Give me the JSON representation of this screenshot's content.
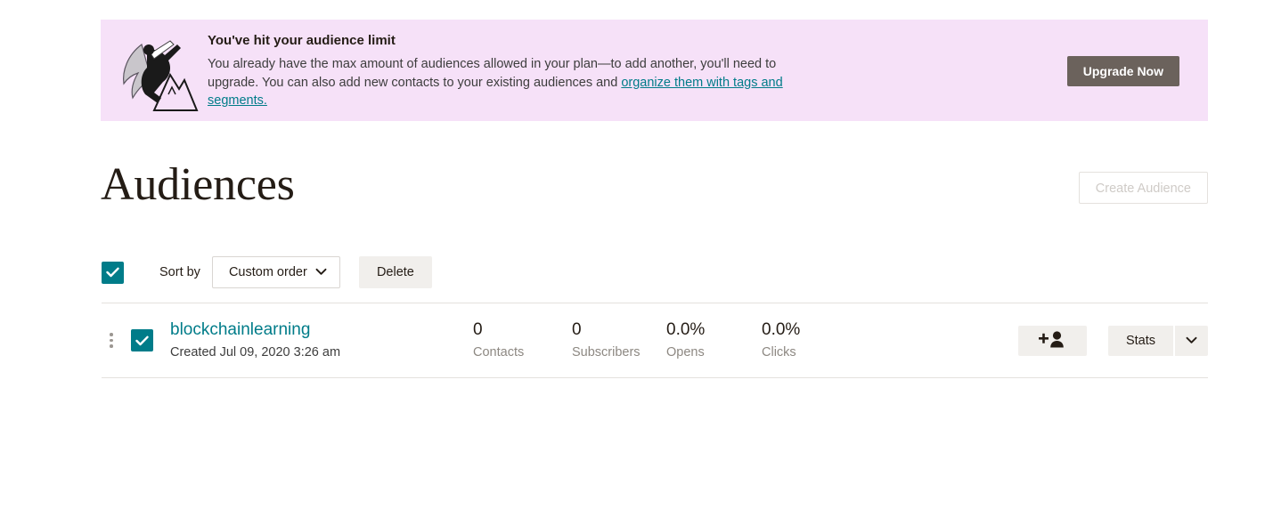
{
  "banner": {
    "illustration": "superhero-leaping-over-mountain-illustration",
    "title": "You've hit your audience limit",
    "text_part1": "You already have the max amount of audiences allowed in your plan—to add another, you'll need to upgrade. You can also add new contacts to your existing audiences and ",
    "link_text": "organize them with tags and segments.",
    "upgrade_label": "Upgrade Now",
    "background_color": "#f6e1f8",
    "link_color": "#007c89",
    "upgrade_button_color": "#6b625c"
  },
  "header": {
    "title": "Audiences",
    "create_label": "Create Audience",
    "create_disabled": true
  },
  "toolbar": {
    "select_all_checked": true,
    "sort_label": "Sort by",
    "sort_value": "Custom order",
    "sort_options": [
      "Custom order"
    ],
    "delete_label": "Delete",
    "accent_color": "#007c89"
  },
  "list": {
    "rows": [
      {
        "checked": true,
        "name": "blockchainlearning",
        "created": "Created Jul 09, 2020 3:26 am",
        "stats": [
          {
            "value": "0",
            "label": "Contacts"
          },
          {
            "value": "0",
            "label": "Subscribers"
          },
          {
            "value": "0.0%",
            "label": "Opens"
          },
          {
            "value": "0.0%",
            "label": "Clicks"
          }
        ],
        "add_contact_icon": "add-person-icon",
        "stats_label": "Stats"
      }
    ]
  }
}
